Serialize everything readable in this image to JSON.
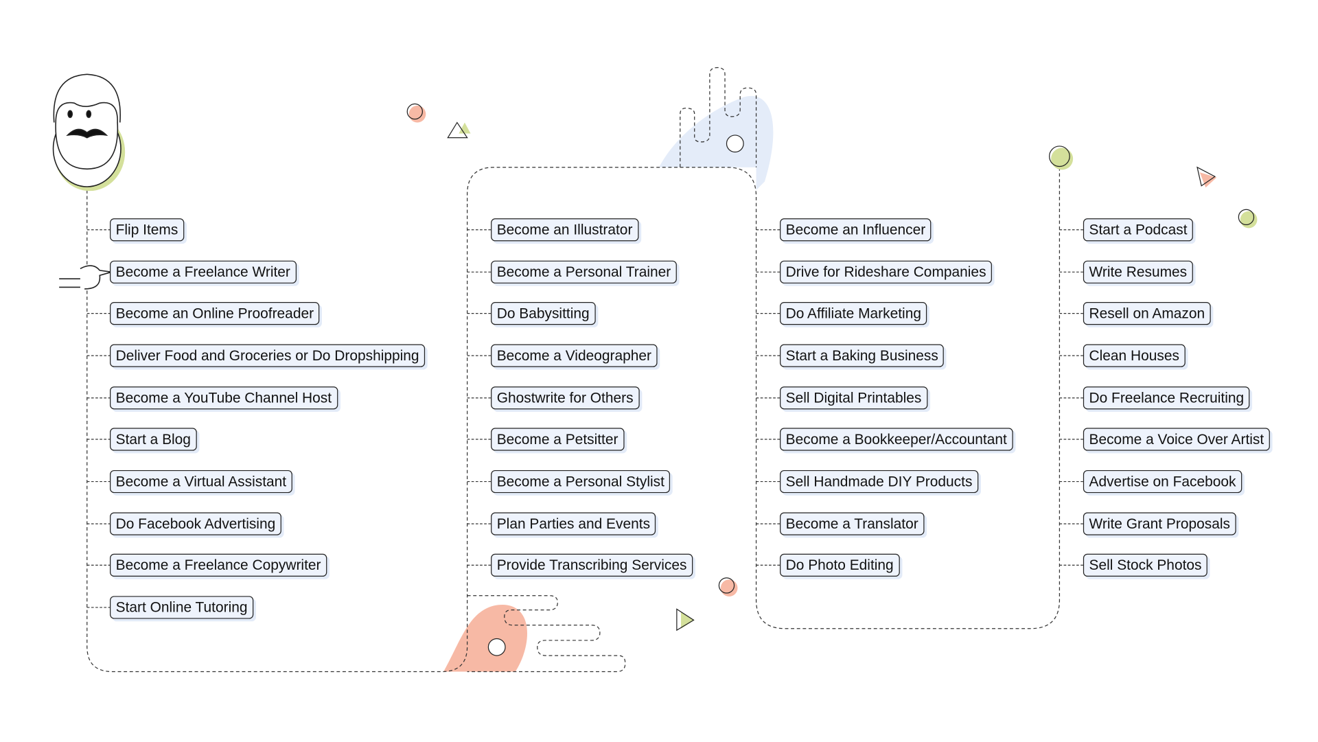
{
  "colors": {
    "accent_green": "#d4e09b",
    "accent_salmon": "#f7b9a5",
    "accent_blue": "#e4ecf9",
    "node_bg": "#eef3fc"
  },
  "icons": [
    "man-face-illustration",
    "pointing-hand-icon"
  ],
  "columns": [
    {
      "items": [
        "Flip Items",
        "Become a Freelance Writer",
        "Become an Online Proofreader",
        "Deliver Food and Groceries or Do Dropshipping",
        "Become a YouTube Channel Host",
        "Start a Blog",
        "Become a Virtual Assistant",
        "Do Facebook Advertising",
        "Become a Freelance Copywriter",
        "Start Online Tutoring"
      ]
    },
    {
      "items": [
        "Become an Illustrator",
        "Become a Personal Trainer",
        "Do Babysitting",
        "Become a Videographer",
        "Ghostwrite for Others",
        "Become a Petsitter",
        "Become a Personal Stylist",
        "Plan Parties and Events",
        "Provide Transcribing Services"
      ]
    },
    {
      "items": [
        "Become an Influencer",
        "Drive for Rideshare Companies",
        "Do Affiliate Marketing",
        "Start a Baking Business",
        "Sell Digital Printables",
        "Become a Bookkeeper/Accountant",
        "Sell Handmade DIY Products",
        "Become a Translator",
        "Do Photo Editing"
      ]
    },
    {
      "items": [
        "Start a Podcast",
        "Write Resumes",
        "Resell on Amazon",
        "Clean Houses",
        "Do Freelance Recruiting",
        "Become a Voice Over Artist",
        "Advertise on Facebook",
        "Write Grant Proposals",
        "Sell Stock Photos"
      ]
    }
  ]
}
